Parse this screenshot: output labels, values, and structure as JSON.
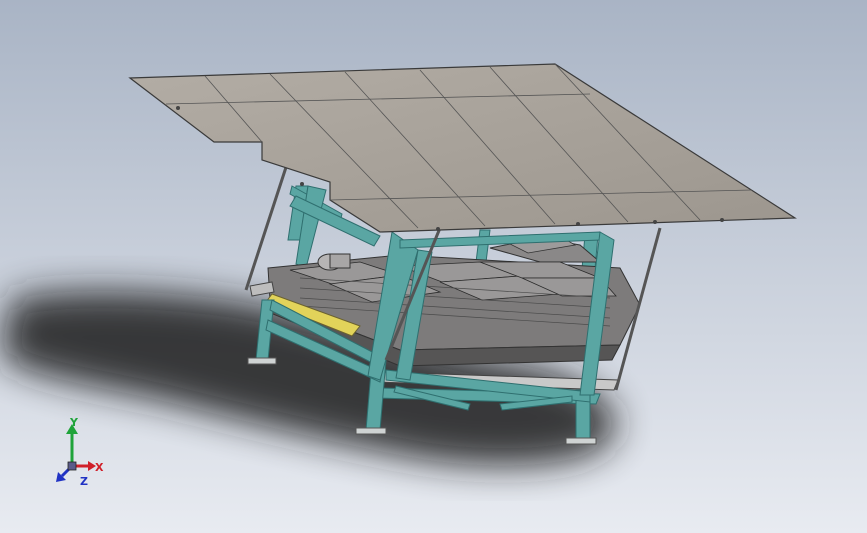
{
  "viewport": {
    "background_top": "#a9b4c5",
    "background_bottom": "#e8ebf1"
  },
  "colors": {
    "frame": "#5aa6a3",
    "frame_dark": "#2f6f6f",
    "panel": "#a59f97",
    "panel_dark": "#8a857e",
    "panel_edge": "#3a3a3a",
    "hopper": "#7d7b7b",
    "hopper_dark": "#565555",
    "accent": "#e2d35a",
    "shadow": "#1c1c1c"
  },
  "triad": {
    "x_label": "X",
    "y_label": "Y",
    "z_label": "Z",
    "x_color": "#d0202a",
    "y_color": "#1fa33a",
    "z_color": "#2032c4"
  }
}
